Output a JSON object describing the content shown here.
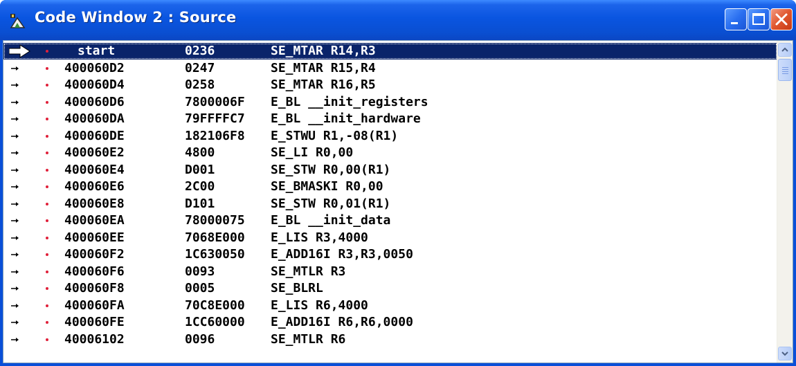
{
  "window": {
    "title": "Code Window 2 : Source",
    "accent_color": "#0a4fd8",
    "selection_color": "#0a246a",
    "icons": {
      "app": "debugger-app-icon",
      "minimize": "minimize-icon",
      "maximize": "maximize-icon",
      "close": "close-icon"
    }
  },
  "listing": {
    "columns": [
      "address",
      "opcode",
      "instruction"
    ],
    "selected_row": 0,
    "rows": [
      {
        "address": "start",
        "opcode": "0236",
        "instruction": "SE_MTAR R14,R3"
      },
      {
        "address": "400060D2",
        "opcode": "0247",
        "instruction": "SE_MTAR R15,R4"
      },
      {
        "address": "400060D4",
        "opcode": "0258",
        "instruction": "SE_MTAR R16,R5"
      },
      {
        "address": "400060D6",
        "opcode": "7800006F",
        "instruction": "E_BL __init_registers"
      },
      {
        "address": "400060DA",
        "opcode": "79FFFFC7",
        "instruction": "E_BL __init_hardware"
      },
      {
        "address": "400060DE",
        "opcode": "182106F8",
        "instruction": "E_STWU R1,-08(R1)"
      },
      {
        "address": "400060E2",
        "opcode": "4800",
        "instruction": "SE_LI R0,00"
      },
      {
        "address": "400060E4",
        "opcode": "D001",
        "instruction": "SE_STW R0,00(R1)"
      },
      {
        "address": "400060E6",
        "opcode": "2C00",
        "instruction": "SE_BMASKI R0,00"
      },
      {
        "address": "400060E8",
        "opcode": "D101",
        "instruction": "SE_STW R0,01(R1)"
      },
      {
        "address": "400060EA",
        "opcode": "78000075",
        "instruction": "E_BL __init_data"
      },
      {
        "address": "400060EE",
        "opcode": "7068E000",
        "instruction": "E_LIS R3,4000"
      },
      {
        "address": "400060F2",
        "opcode": "1C630050",
        "instruction": "E_ADD16I R3,R3,0050"
      },
      {
        "address": "400060F6",
        "opcode": "0093",
        "instruction": "SE_MTLR R3"
      },
      {
        "address": "400060F8",
        "opcode": "0005",
        "instruction": "SE_BLRL"
      },
      {
        "address": "400060FA",
        "opcode": "70C8E000",
        "instruction": "E_LIS R6,4000"
      },
      {
        "address": "400060FE",
        "opcode": "1CC60000",
        "instruction": "E_ADD16I R6,R6,0000"
      },
      {
        "address": "40006102",
        "opcode": "0096",
        "instruction": "SE_MTLR R6"
      }
    ]
  },
  "scrollbar": {
    "up_icon": "scroll-up-arrow-icon",
    "down_icon": "scroll-down-arrow-icon"
  }
}
